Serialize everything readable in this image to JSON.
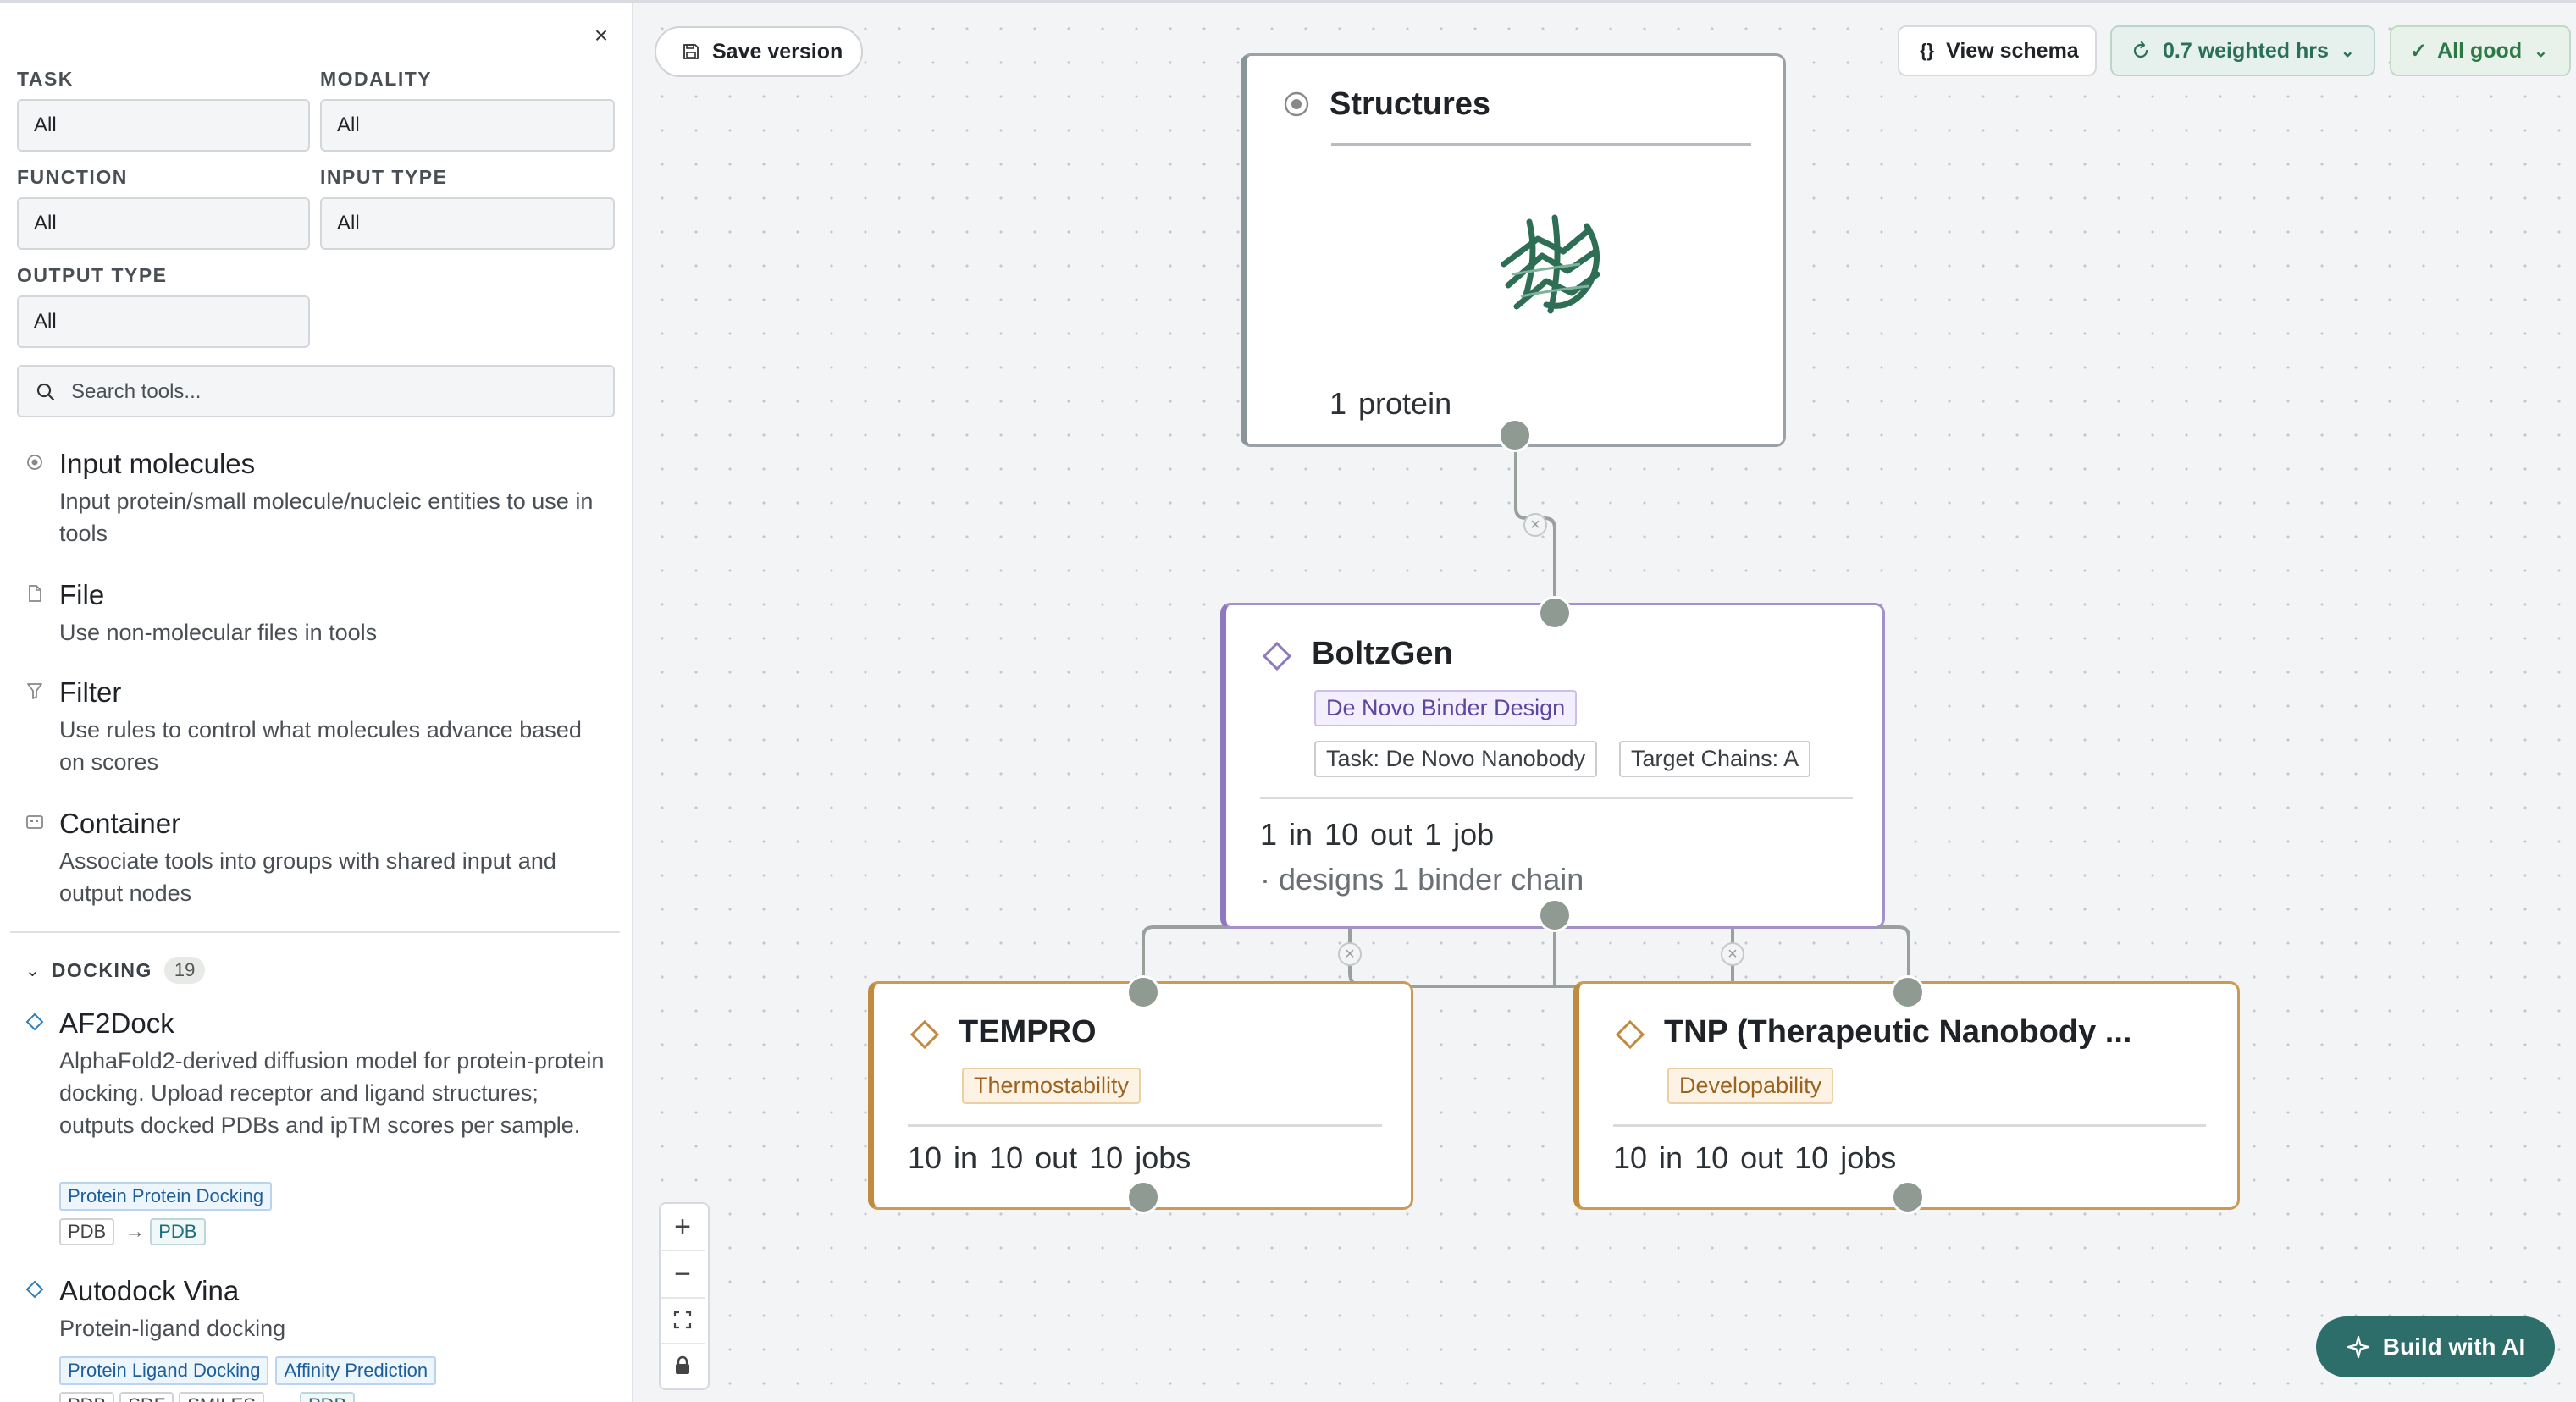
{
  "filters": {
    "task_label": "TASK",
    "task_value": "All",
    "modality_label": "MODALITY",
    "modality_value": "All",
    "function_label": "FUNCTION",
    "function_value": "All",
    "input_type_label": "INPUT TYPE",
    "input_type_value": "All",
    "output_type_label": "OUTPUT TYPE",
    "output_type_value": "All"
  },
  "search": {
    "placeholder": "Search tools..."
  },
  "tools": [
    {
      "name": "Input molecules",
      "description": "Input protein/small molecule/nucleic entities to use in tools",
      "icon": "radio-icon"
    },
    {
      "name": "File",
      "description": "Use non-molecular files in tools",
      "icon": "file-icon"
    },
    {
      "name": "Filter",
      "description": "Use rules to control what molecules advance based on scores",
      "icon": "filter-icon"
    },
    {
      "name": "Container",
      "description": "Associate tools into groups with shared input and output nodes",
      "icon": "container-icon"
    }
  ],
  "section": {
    "name": "DOCKING",
    "count": "19"
  },
  "docking_tools": [
    {
      "name": "AF2Dock",
      "description": "AlphaFold2-derived diffusion model for protein-protein docking. Upload receptor and ligand structures; outputs docked PDBs and ipTM scores per sample.",
      "tags": [
        "Protein Protein Docking"
      ],
      "inputs": [
        "PDB"
      ],
      "outputs": [
        "PDB"
      ]
    },
    {
      "name": "Autodock Vina",
      "description": "Protein-ligand docking",
      "tags": [
        "Protein Ligand Docking",
        "Affinity Prediction"
      ],
      "inputs": [
        "PDB",
        "SDF",
        "SMILES"
      ],
      "outputs": [
        "PDB"
      ]
    }
  ],
  "toolbar": {
    "save_label": "Save version",
    "schema_label": "View schema",
    "hours_label": "0.7 weighted hrs",
    "status_label": "All good"
  },
  "nodes": {
    "structures": {
      "title": "Structures",
      "count": "1 protein"
    },
    "boltzgen": {
      "title": "BoltzGen",
      "category": "De Novo Binder Design",
      "params": [
        "Task: De Novo Nanobody",
        "Target Chains: A"
      ],
      "stats": "1 in  10 out  1 job",
      "subtitle": "· designs 1 binder chain"
    },
    "tempro": {
      "title": "TEMPRO",
      "category": "Thermostability",
      "stats": "10 in  10 out  10 jobs"
    },
    "tnp": {
      "title": "TNP (Therapeutic Nanobody ...",
      "category": "Developability",
      "stats": "10 in  10 out  10 jobs"
    }
  },
  "build_label": "Build with AI",
  "colors": {
    "accent": "#2d6e6a",
    "boltz": "#8e79bf",
    "scorer": "#c18a3f",
    "handle": "#8f9a92"
  }
}
